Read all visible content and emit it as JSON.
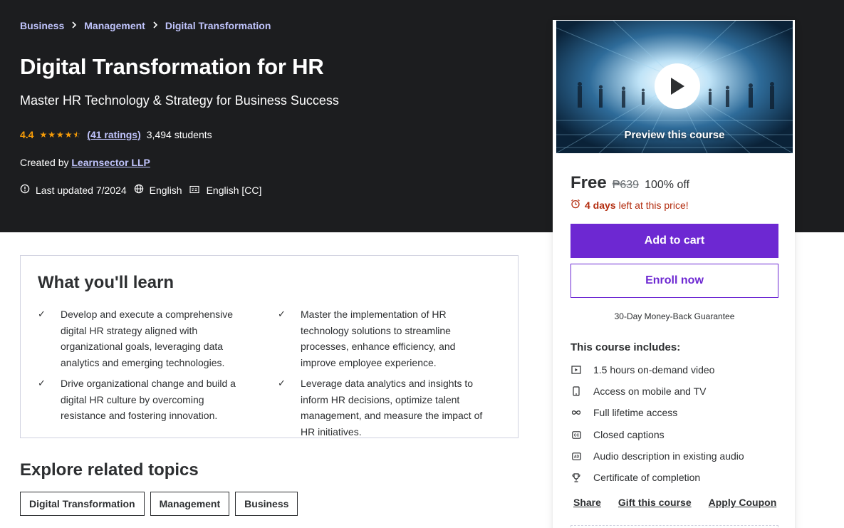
{
  "breadcrumb": {
    "items": [
      "Business",
      "Management",
      "Digital Transformation"
    ]
  },
  "course": {
    "title": "Digital Transformation for HR",
    "subtitle": "Master HR Technology & Strategy for Business Success",
    "rating": "4.4",
    "rating_stars": 4.4,
    "ratings_link": "(41 ratings)",
    "students": "3,494 students",
    "created_prefix": "Created by",
    "instructor": "Learnsector LLP",
    "last_updated": "Last updated 7/2024",
    "language": "English",
    "captions": "English [CC]"
  },
  "learn": {
    "title": "What you'll learn",
    "items": [
      "Develop and execute a comprehensive digital HR strategy aligned with organizational goals, leveraging data analytics and emerging technologies.",
      "Master the implementation of HR technology solutions to streamline processes, enhance efficiency, and improve employee experience.",
      "Drive organizational change and build a digital HR culture by overcoming resistance and fostering innovation.",
      "Leverage data analytics and insights to inform HR decisions, optimize talent management, and measure the impact of HR initiatives."
    ]
  },
  "explore": {
    "title": "Explore related topics",
    "topics": [
      "Digital Transformation",
      "Management",
      "Business"
    ]
  },
  "sidebar": {
    "preview_label": "Preview this course",
    "price": "Free",
    "original_price": "₱639",
    "discount": "100% off",
    "urgency_bold": "4 days",
    "urgency_rest": "left at this price!",
    "add_to_cart": "Add to cart",
    "enroll_now": "Enroll now",
    "guarantee": "30-Day Money-Back Guarantee",
    "includes_title": "This course includes:",
    "includes": [
      {
        "icon": "video-icon",
        "label": "1.5 hours on-demand video"
      },
      {
        "icon": "mobile-icon",
        "label": "Access on mobile and TV"
      },
      {
        "icon": "infinity-icon",
        "label": "Full lifetime access"
      },
      {
        "icon": "closed-captions-icon",
        "label": "Closed captions"
      },
      {
        "icon": "audio-description-icon",
        "label": "Audio description in existing audio"
      },
      {
        "icon": "trophy-icon",
        "label": "Certificate of completion"
      }
    ],
    "share": "Share",
    "gift": "Gift this course",
    "coupon": "Apply Coupon"
  },
  "colors": {
    "hero_bg": "#1c1d1f",
    "link_purple_light": "#c0c4fc",
    "star_orange": "#f69c08",
    "brand_purple": "#6d28d2",
    "urgency_red": "#b32d0f"
  }
}
